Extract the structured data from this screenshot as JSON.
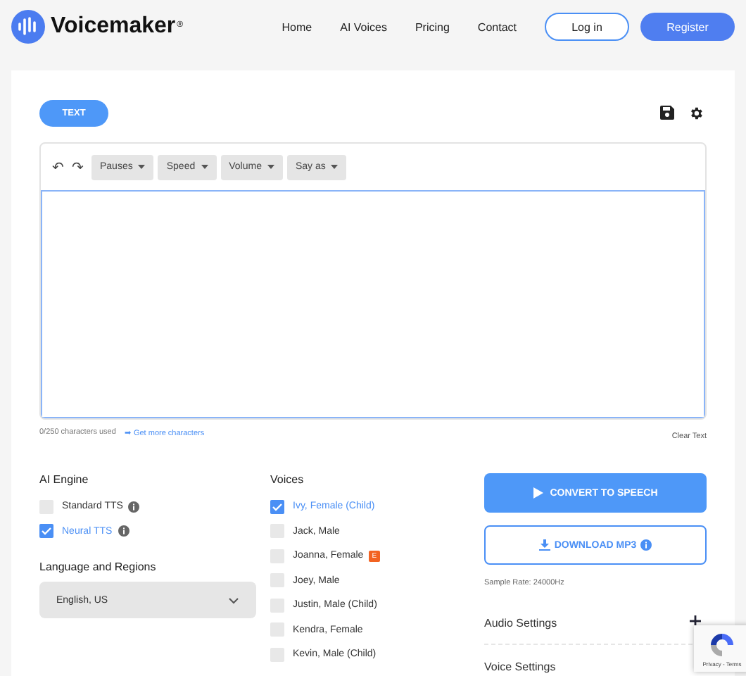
{
  "header": {
    "logo": "Voicemaker",
    "logo_mark": "®",
    "nav": [
      "Home",
      "AI Voices",
      "Pricing",
      "Contact"
    ],
    "login": "Log in",
    "register": "Register"
  },
  "mode_tab": {
    "label": "TEXT",
    "selected": true
  },
  "toolbar": {
    "undo": "↶",
    "redo": "↷",
    "dropdowns": [
      "Pauses",
      "Speed",
      "Volume",
      "Say as"
    ]
  },
  "editor": {
    "counter": "0/250 characters used",
    "more_link": "➡ Get more characters",
    "clear": "Clear Text"
  },
  "engine": {
    "title": "AI Engine",
    "options": [
      {
        "label": "Standard TTS",
        "checked": false
      },
      {
        "label": "Neural TTS",
        "checked": true
      }
    ]
  },
  "language": {
    "title": "Language and Regions",
    "value": "English, US"
  },
  "voices": {
    "title": "Voices",
    "items": [
      {
        "label": "Ivy, Female (Child)",
        "checked": true
      },
      {
        "label": "Jack, Male",
        "checked": false
      },
      {
        "label": "Joanna, Female",
        "checked": false,
        "badge": "E"
      },
      {
        "label": "Joey, Male",
        "checked": false
      },
      {
        "label": "Justin, Male (Child)",
        "checked": false
      },
      {
        "label": "Kendra, Female",
        "checked": false
      },
      {
        "label": "Kevin, Male (Child)",
        "checked": false
      }
    ]
  },
  "actions": {
    "convert": "CONVERT TO SPEECH",
    "download": "DOWNLOAD MP3",
    "sample_rate": "Sample Rate: 24000Hz"
  },
  "settings": [
    {
      "label": "Audio Settings",
      "expanded": false
    },
    {
      "label": "Voice Settings"
    }
  ],
  "recaptcha": {
    "links": "Privacy - Terms"
  }
}
